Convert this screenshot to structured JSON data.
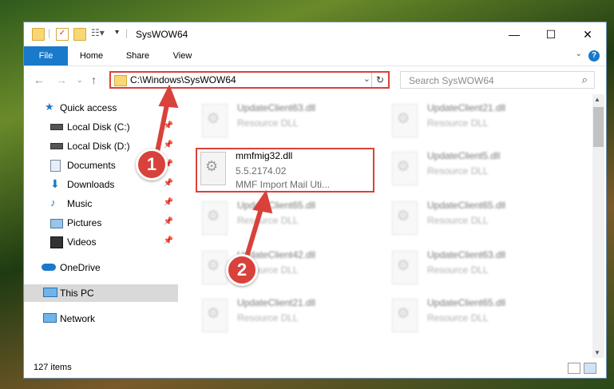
{
  "window": {
    "title": "SysWOW64"
  },
  "ribbon": {
    "tabs": [
      "File",
      "Home",
      "Share",
      "View"
    ]
  },
  "address": {
    "path": "C:\\Windows\\SysWOW64"
  },
  "search": {
    "placeholder": "Search SysWOW64"
  },
  "nav": {
    "quick_access": "Quick access",
    "items": [
      {
        "label": "Local Disk (C:)",
        "icon": "drive-icon"
      },
      {
        "label": "Local Disk (D:)",
        "icon": "drive-icon"
      },
      {
        "label": "Documents",
        "icon": "documents-icon"
      },
      {
        "label": "Downloads",
        "icon": "downloads-icon"
      },
      {
        "label": "Music",
        "icon": "music-icon"
      },
      {
        "label": "Pictures",
        "icon": "pictures-icon"
      },
      {
        "label": "Videos",
        "icon": "videos-icon"
      }
    ],
    "onedrive": "OneDrive",
    "this_pc": "This PC",
    "network": "Network"
  },
  "files": {
    "selected": {
      "name": "mmfmig32.dll",
      "version": "5.5.2174.02",
      "description": "MMF Import Mail Uti..."
    },
    "left": [
      {
        "name": "UpdateClient63.dll",
        "type": "Resource DLL"
      },
      {
        "name": "UpdateClient65.dll",
        "type": "Resource DLL"
      },
      {
        "name": "UpdateClient42.dll",
        "type": "Resource DLL"
      },
      {
        "name": "UpdateClient21.dll",
        "type": "Resource DLL"
      }
    ],
    "right": [
      {
        "name": "UpdateClient21.dll",
        "type": "Resource DLL"
      },
      {
        "name": "UpdateClient5.dll",
        "type": "Resource DLL"
      },
      {
        "name": "UpdateClient65.dll",
        "type": "Resource DLL"
      },
      {
        "name": "UpdateClient63.dll",
        "type": "Resource DLL"
      },
      {
        "name": "UpdateClient65.dll",
        "type": "Resource DLL"
      }
    ]
  },
  "status": {
    "count": "127 items"
  },
  "annotations": {
    "one": "1",
    "two": "2"
  },
  "colors": {
    "accent": "#1979ca",
    "annotation": "#d9413b"
  }
}
